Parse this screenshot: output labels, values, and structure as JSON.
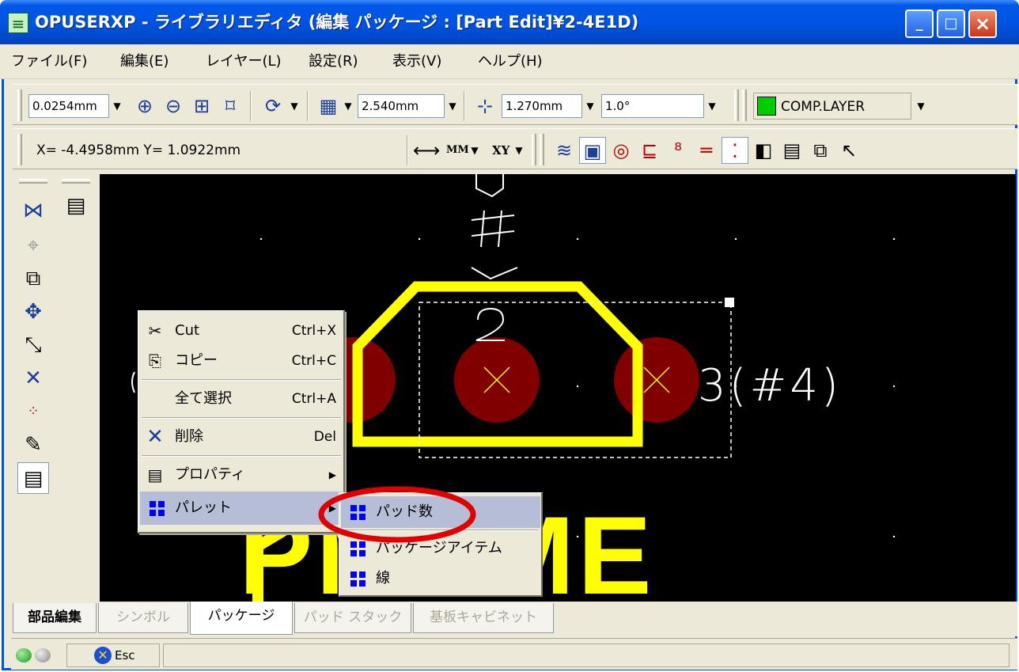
{
  "title_bar": {
    "icon": "app-icon",
    "title": "OPUSERXP - ライブラリエディタ (編集 パッケージ : [Part Edit]¥2-4E1D)"
  },
  "menu": [
    "ファイル(F)",
    "編集(E)",
    "レイヤー(L)",
    "設定(R)",
    "表示(V)",
    "ヘルプ(H)"
  ],
  "toolbar1": {
    "unit": "0.0254mm",
    "grid": "2.540mm",
    "snap": "1.270mm",
    "angle": "1.0°",
    "layer": "COMP.LAYER",
    "layer_color": "#00cc00"
  },
  "toolbar2": {
    "coords": "X= -4.4958mm  Y= 1.0922mm",
    "unit_mode": "MM",
    "axis_mode": "XY"
  },
  "canvas": {
    "pad_label": "3(#4)",
    "partname": "PNAME",
    "colors": {
      "pad": "#800000",
      "outline": "#ffff00",
      "background": "#000000",
      "text": "#ffffff"
    }
  },
  "context_menu": {
    "items": [
      {
        "icon": "cut-icon",
        "label": "Cut",
        "shortcut": "Ctrl+X"
      },
      {
        "icon": "copy-icon",
        "label": "コピー",
        "shortcut": "Ctrl+C"
      },
      {
        "icon": "",
        "label": "全て選択",
        "shortcut": "Ctrl+A"
      },
      {
        "icon": "delete-icon",
        "label": "削除",
        "shortcut": "Del"
      },
      {
        "icon": "properties-icon",
        "label": "プロパティ",
        "shortcut": ""
      },
      {
        "icon": "palette-icon",
        "label": "パレット",
        "shortcut": ""
      }
    ],
    "submenu": [
      {
        "icon": "palette-icon",
        "label": "パッド数"
      },
      {
        "icon": "palette-icon",
        "label": "パッケージアイテム"
      },
      {
        "icon": "palette-icon",
        "label": "線"
      }
    ],
    "highlight_color": "#e00000"
  },
  "tabs": [
    {
      "label": "部品編集",
      "state": "bold"
    },
    {
      "label": "シンボル",
      "state": "disabled"
    },
    {
      "label": "パッケージ",
      "state": "active"
    },
    {
      "label": "パッド スタック",
      "state": "disabled"
    },
    {
      "label": "基板キャビネット",
      "state": "disabled"
    }
  ],
  "statusbar": {
    "esc_label": "Esc"
  }
}
